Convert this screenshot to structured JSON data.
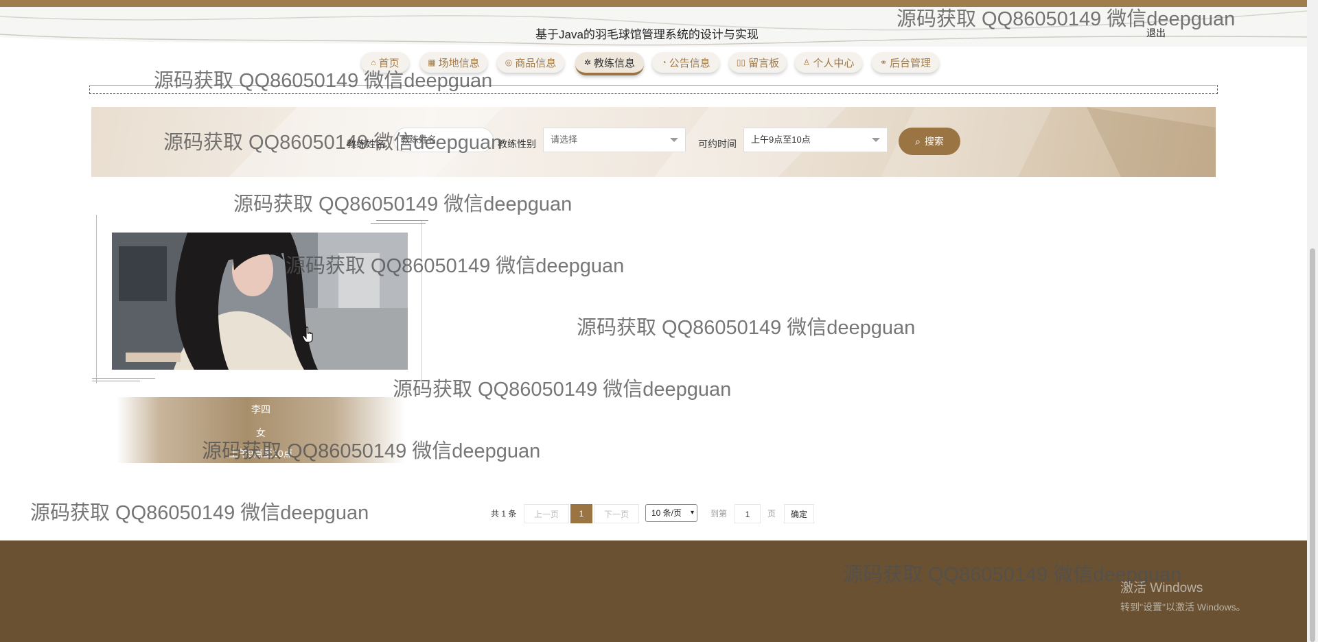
{
  "header": {
    "title": "基于Java的羽毛球馆管理系统的设计与实现",
    "logout_label": "退出"
  },
  "nav": [
    {
      "label": "首页",
      "icon": "home-icon"
    },
    {
      "label": "场地信息",
      "icon": "venue-icon"
    },
    {
      "label": "商品信息",
      "icon": "goods-icon"
    },
    {
      "label": "教练信息",
      "icon": "coach-icon",
      "active": true
    },
    {
      "label": "公告信息",
      "icon": "notice-icon"
    },
    {
      "label": "留言板",
      "icon": "message-icon"
    },
    {
      "label": "个人中心",
      "icon": "user-icon"
    },
    {
      "label": "后台管理",
      "icon": "link-icon"
    }
  ],
  "search": {
    "name_label": "教练姓名",
    "name_placeholder": "教练姓名",
    "gender_label": "教练性别",
    "gender_value": "请选择",
    "time_label": "可约时间",
    "time_value": "上午9点至10点",
    "button_label": "搜索"
  },
  "coach": {
    "name": "李四",
    "gender": "女",
    "time": "上午9点至10点"
  },
  "pagination": {
    "total_text": "共 1 条",
    "prev_label": "上一页",
    "current_page": "1",
    "next_label": "下一页",
    "page_size": "10 条/页",
    "goto_label": "到第",
    "goto_value": "1",
    "page_unit": "页",
    "confirm_label": "确定"
  },
  "watermark": {
    "text": "源码获取 QQ86050149 微信deepguan"
  },
  "windows_activation": {
    "line1": "激活 Windows",
    "line2": "转到\"设置\"以激活 Windows。"
  },
  "colors": {
    "accent": "#9a7442",
    "footer": "#6a5132",
    "nav_text": "#a27a48"
  }
}
